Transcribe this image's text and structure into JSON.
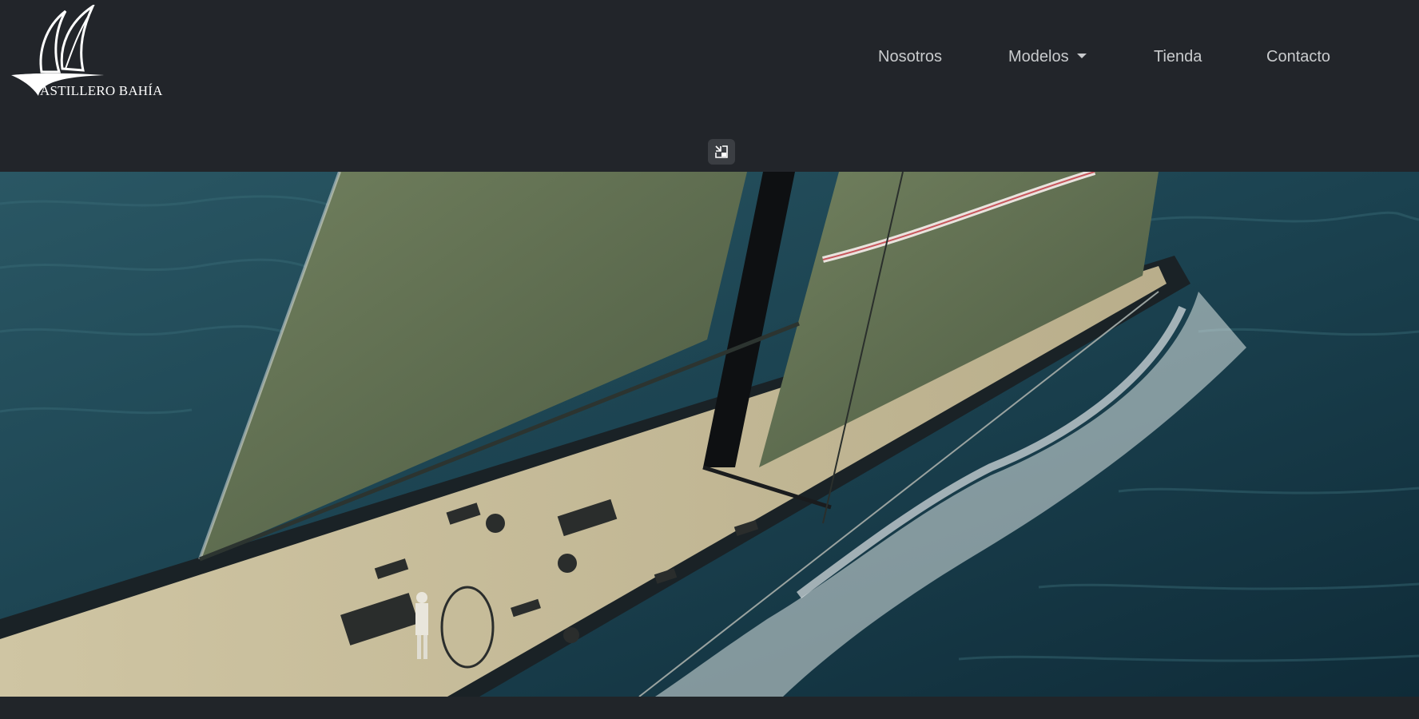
{
  "brand": {
    "logo_text": "ASTILLERO BAHÍA"
  },
  "nav": {
    "items": [
      {
        "label": "Nosotros"
      },
      {
        "label": "Modelos",
        "has_dropdown": true
      },
      {
        "label": "Tienda"
      },
      {
        "label": "Contacto"
      }
    ]
  },
  "video": {
    "pip_icon": "picture-in-picture-exit-icon",
    "subject": "sailboat-at-sea"
  },
  "colors": {
    "background": "#212529",
    "nav_text": "#c9cbcd",
    "sea": "#1d4450",
    "sail": "#5c6a4f",
    "deck": "#c9c0a0"
  }
}
